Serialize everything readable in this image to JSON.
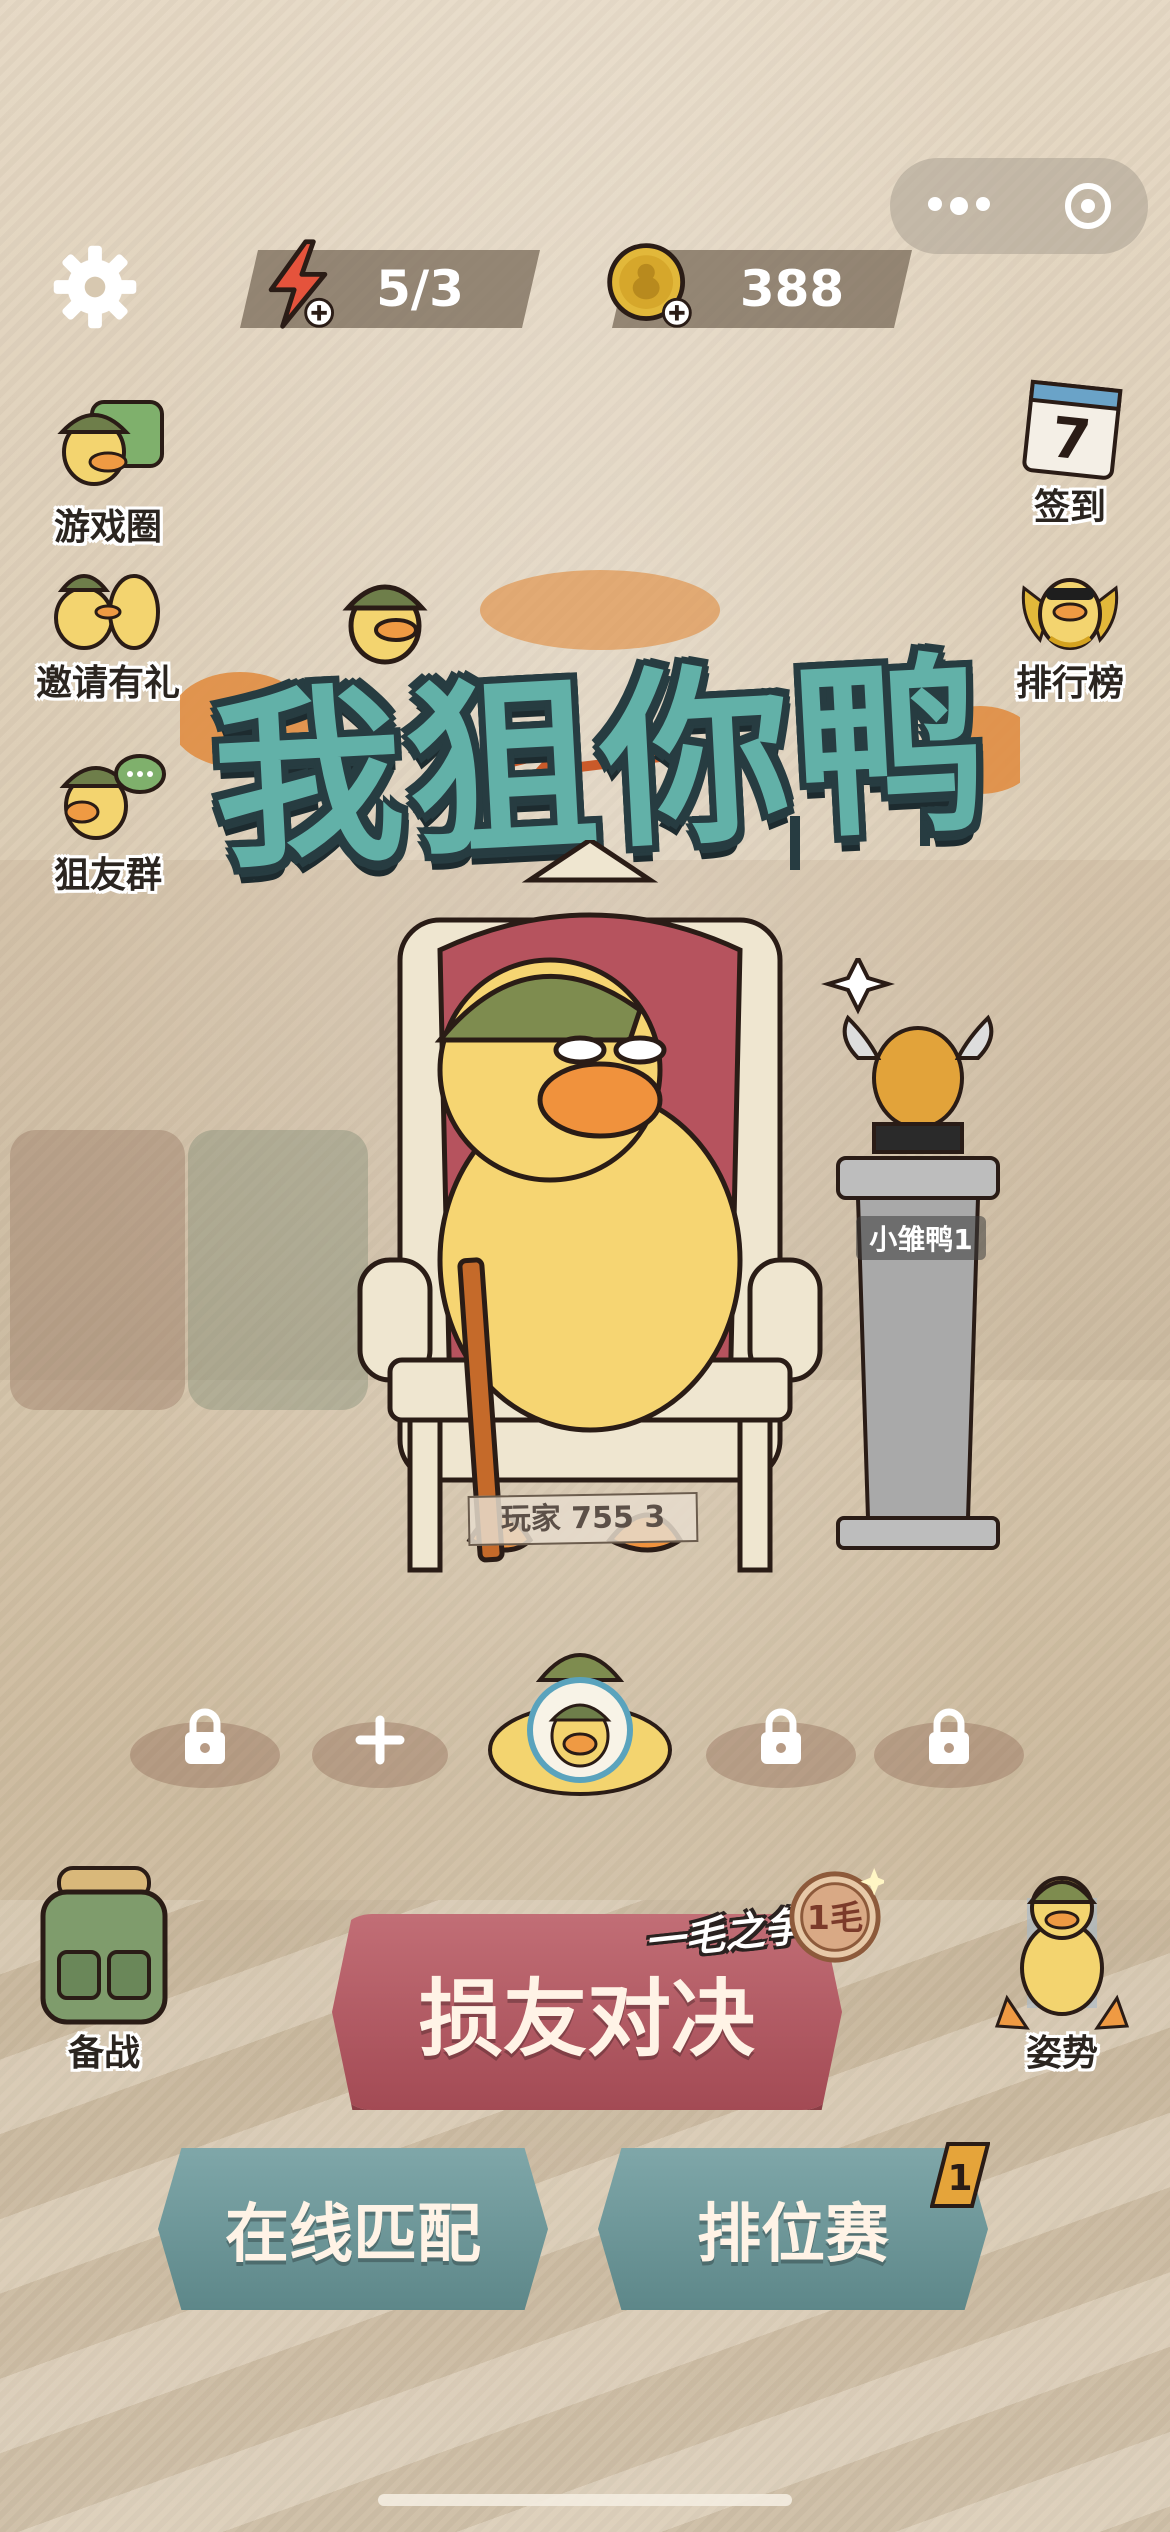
{
  "header": {
    "energy": "5/3",
    "coins": "388"
  },
  "left_menu": [
    {
      "label": "游戏圈"
    },
    {
      "label": "邀请有礼"
    },
    {
      "label": "狙友群"
    }
  ],
  "right_menu": [
    {
      "label": "签到",
      "calendar_day": "7"
    },
    {
      "label": "排行榜"
    }
  ],
  "logo_text": "我狙你鸭",
  "pedestal_label": "小雏鸭1",
  "player_plate": "玩家  755  3",
  "bottom_side": {
    "left_label": "备战",
    "right_label": "姿势"
  },
  "buttons": {
    "main": "损友对决",
    "main_tag": "一毛之争",
    "coin_badge": "1毛",
    "online": "在线匹配",
    "ranked": "排位赛",
    "ranked_badge": "1"
  },
  "slots": [
    {
      "type": "lock-icon"
    },
    {
      "type": "plus-icon"
    },
    {
      "type": "avatar"
    },
    {
      "type": "lock-icon"
    },
    {
      "type": "lock-icon"
    }
  ],
  "colors": {
    "main_button": "#b25a63",
    "teal_button": "#6f9a9c",
    "logo": "#62b1a8"
  }
}
